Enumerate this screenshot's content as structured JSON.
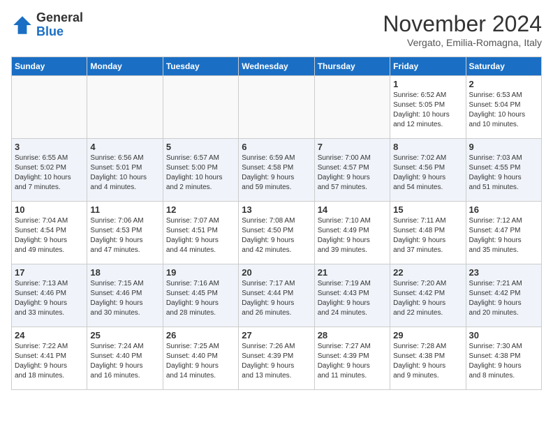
{
  "header": {
    "logo_line1": "General",
    "logo_line2": "Blue",
    "month": "November 2024",
    "location": "Vergato, Emilia-Romagna, Italy"
  },
  "weekdays": [
    "Sunday",
    "Monday",
    "Tuesday",
    "Wednesday",
    "Thursday",
    "Friday",
    "Saturday"
  ],
  "weeks": [
    [
      {
        "day": "",
        "info": ""
      },
      {
        "day": "",
        "info": ""
      },
      {
        "day": "",
        "info": ""
      },
      {
        "day": "",
        "info": ""
      },
      {
        "day": "",
        "info": ""
      },
      {
        "day": "1",
        "info": "Sunrise: 6:52 AM\nSunset: 5:05 PM\nDaylight: 10 hours\nand 12 minutes."
      },
      {
        "day": "2",
        "info": "Sunrise: 6:53 AM\nSunset: 5:04 PM\nDaylight: 10 hours\nand 10 minutes."
      }
    ],
    [
      {
        "day": "3",
        "info": "Sunrise: 6:55 AM\nSunset: 5:02 PM\nDaylight: 10 hours\nand 7 minutes."
      },
      {
        "day": "4",
        "info": "Sunrise: 6:56 AM\nSunset: 5:01 PM\nDaylight: 10 hours\nand 4 minutes."
      },
      {
        "day": "5",
        "info": "Sunrise: 6:57 AM\nSunset: 5:00 PM\nDaylight: 10 hours\nand 2 minutes."
      },
      {
        "day": "6",
        "info": "Sunrise: 6:59 AM\nSunset: 4:58 PM\nDaylight: 9 hours\nand 59 minutes."
      },
      {
        "day": "7",
        "info": "Sunrise: 7:00 AM\nSunset: 4:57 PM\nDaylight: 9 hours\nand 57 minutes."
      },
      {
        "day": "8",
        "info": "Sunrise: 7:02 AM\nSunset: 4:56 PM\nDaylight: 9 hours\nand 54 minutes."
      },
      {
        "day": "9",
        "info": "Sunrise: 7:03 AM\nSunset: 4:55 PM\nDaylight: 9 hours\nand 51 minutes."
      }
    ],
    [
      {
        "day": "10",
        "info": "Sunrise: 7:04 AM\nSunset: 4:54 PM\nDaylight: 9 hours\nand 49 minutes."
      },
      {
        "day": "11",
        "info": "Sunrise: 7:06 AM\nSunset: 4:53 PM\nDaylight: 9 hours\nand 47 minutes."
      },
      {
        "day": "12",
        "info": "Sunrise: 7:07 AM\nSunset: 4:51 PM\nDaylight: 9 hours\nand 44 minutes."
      },
      {
        "day": "13",
        "info": "Sunrise: 7:08 AM\nSunset: 4:50 PM\nDaylight: 9 hours\nand 42 minutes."
      },
      {
        "day": "14",
        "info": "Sunrise: 7:10 AM\nSunset: 4:49 PM\nDaylight: 9 hours\nand 39 minutes."
      },
      {
        "day": "15",
        "info": "Sunrise: 7:11 AM\nSunset: 4:48 PM\nDaylight: 9 hours\nand 37 minutes."
      },
      {
        "day": "16",
        "info": "Sunrise: 7:12 AM\nSunset: 4:47 PM\nDaylight: 9 hours\nand 35 minutes."
      }
    ],
    [
      {
        "day": "17",
        "info": "Sunrise: 7:13 AM\nSunset: 4:46 PM\nDaylight: 9 hours\nand 33 minutes."
      },
      {
        "day": "18",
        "info": "Sunrise: 7:15 AM\nSunset: 4:46 PM\nDaylight: 9 hours\nand 30 minutes."
      },
      {
        "day": "19",
        "info": "Sunrise: 7:16 AM\nSunset: 4:45 PM\nDaylight: 9 hours\nand 28 minutes."
      },
      {
        "day": "20",
        "info": "Sunrise: 7:17 AM\nSunset: 4:44 PM\nDaylight: 9 hours\nand 26 minutes."
      },
      {
        "day": "21",
        "info": "Sunrise: 7:19 AM\nSunset: 4:43 PM\nDaylight: 9 hours\nand 24 minutes."
      },
      {
        "day": "22",
        "info": "Sunrise: 7:20 AM\nSunset: 4:42 PM\nDaylight: 9 hours\nand 22 minutes."
      },
      {
        "day": "23",
        "info": "Sunrise: 7:21 AM\nSunset: 4:42 PM\nDaylight: 9 hours\nand 20 minutes."
      }
    ],
    [
      {
        "day": "24",
        "info": "Sunrise: 7:22 AM\nSunset: 4:41 PM\nDaylight: 9 hours\nand 18 minutes."
      },
      {
        "day": "25",
        "info": "Sunrise: 7:24 AM\nSunset: 4:40 PM\nDaylight: 9 hours\nand 16 minutes."
      },
      {
        "day": "26",
        "info": "Sunrise: 7:25 AM\nSunset: 4:40 PM\nDaylight: 9 hours\nand 14 minutes."
      },
      {
        "day": "27",
        "info": "Sunrise: 7:26 AM\nSunset: 4:39 PM\nDaylight: 9 hours\nand 13 minutes."
      },
      {
        "day": "28",
        "info": "Sunrise: 7:27 AM\nSunset: 4:39 PM\nDaylight: 9 hours\nand 11 minutes."
      },
      {
        "day": "29",
        "info": "Sunrise: 7:28 AM\nSunset: 4:38 PM\nDaylight: 9 hours\nand 9 minutes."
      },
      {
        "day": "30",
        "info": "Sunrise: 7:30 AM\nSunset: 4:38 PM\nDaylight: 9 hours\nand 8 minutes."
      }
    ]
  ]
}
